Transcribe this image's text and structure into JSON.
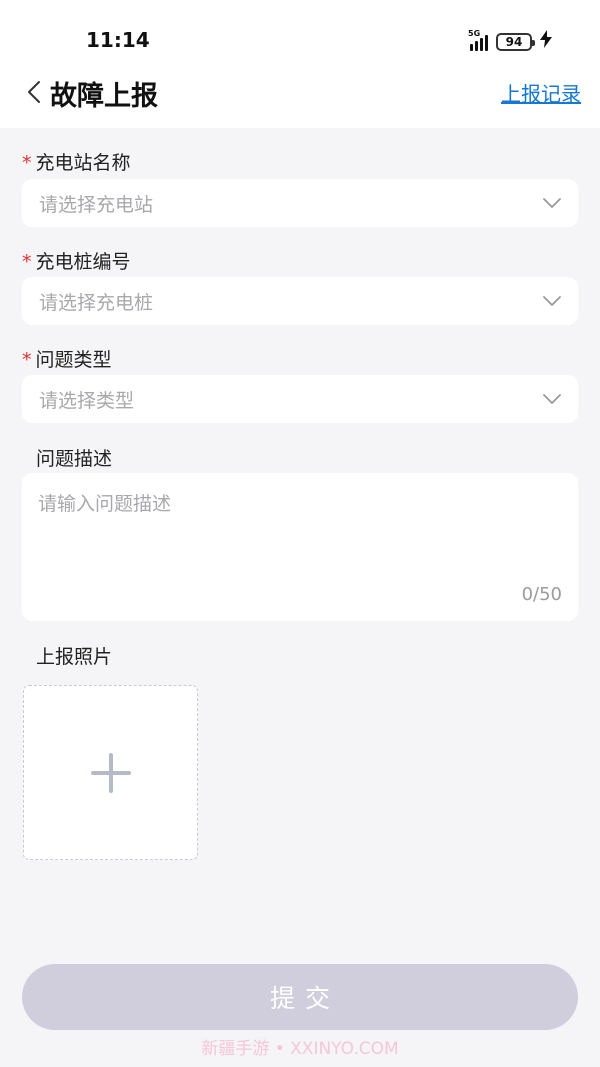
{
  "status_bar": {
    "time": "11:14",
    "network": "5G",
    "battery": "94"
  },
  "header": {
    "title": "故障上报",
    "history_link": "上报记录"
  },
  "form": {
    "required_mark": "*",
    "station": {
      "label": "充电站名称",
      "placeholder": "请选择充电站"
    },
    "charger": {
      "label": "充电桩编号",
      "placeholder": "请选择充电桩"
    },
    "issue_type": {
      "label": "问题类型",
      "placeholder": "请选择类型"
    },
    "description": {
      "label": "问题描述",
      "placeholder": "请输入问题描述",
      "counter": "0/50"
    },
    "photos": {
      "label": "上报照片"
    },
    "submit_label": "提交"
  },
  "watermark": "新疆手游 • XXINYO.COM",
  "colors": {
    "accent_link": "#1677d2",
    "required": "#e0312b",
    "submit_disabled": "#d0cedc",
    "background": "#f5f5f7"
  },
  "icons": {
    "back": "chevron-left-icon",
    "dropdown": "chevron-down-icon",
    "upload": "plus-icon",
    "charging": "bolt-icon"
  }
}
